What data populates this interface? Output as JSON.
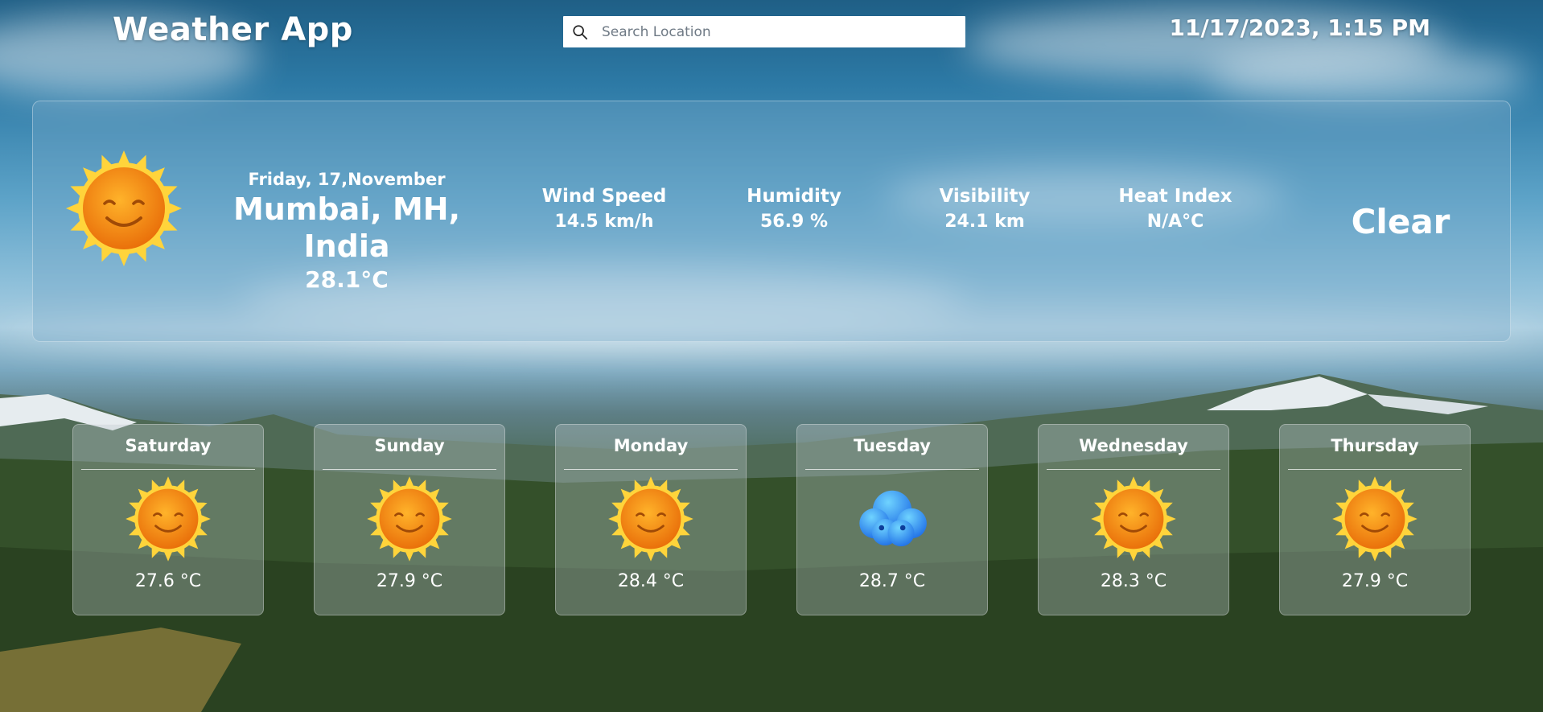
{
  "app": {
    "title": "Weather App"
  },
  "search": {
    "placeholder": "Search Location",
    "value": ""
  },
  "datetime": "11/17/2023, 1:15 PM",
  "current": {
    "icon": "sun-smiling-icon",
    "date": "Friday, 17,November",
    "location": "Mumbai, MH, India",
    "temperature": "28.1°C",
    "condition": "Clear",
    "metrics": [
      {
        "label": "Wind Speed",
        "value": "14.5 km/h"
      },
      {
        "label": "Humidity",
        "value": "56.9 %"
      },
      {
        "label": "Visibility",
        "value": "24.1 km"
      },
      {
        "label": "Heat Index",
        "value": "N/A°C"
      }
    ]
  },
  "forecast": [
    {
      "day": "Saturday",
      "icon": "sun-smiling-icon",
      "temp": "27.6 °C"
    },
    {
      "day": "Sunday",
      "icon": "sun-smiling-icon",
      "temp": "27.9 °C"
    },
    {
      "day": "Monday",
      "icon": "sun-smiling-icon",
      "temp": "28.4 °C"
    },
    {
      "day": "Tuesday",
      "icon": "cloud-icon",
      "temp": "28.7 °C"
    },
    {
      "day": "Wednesday",
      "icon": "sun-smiling-icon",
      "temp": "28.3 °C"
    },
    {
      "day": "Thursday",
      "icon": "sun-smiling-icon",
      "temp": "27.9 °C"
    }
  ],
  "colors": {
    "sun_core": "#f59a0c",
    "sun_rays": "#ffd43b",
    "cloud": "#2f9cf5"
  }
}
